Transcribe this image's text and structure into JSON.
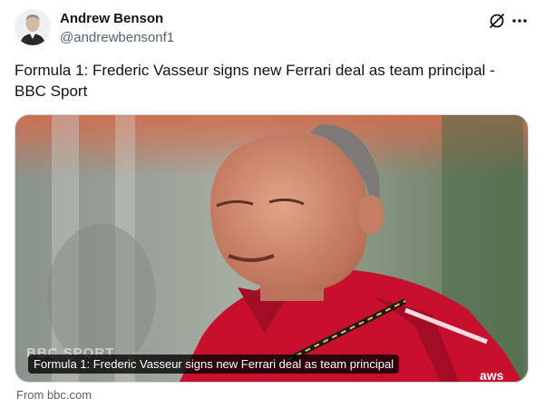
{
  "author": {
    "name": "Andrew Benson",
    "handle": "@andrewbensonf1"
  },
  "tweet": {
    "text": "Formula 1: Frederic Vasseur signs new Ferrari deal as team principal - BBC Sport"
  },
  "card": {
    "caption": "Formula 1: Frederic Vasseur signs new Ferrari deal as team principal",
    "watermark": "BBC SPORT",
    "source": "From bbc.com"
  },
  "icons": {
    "grok": "grok-icon",
    "more": "more-icon"
  },
  "colors": {
    "text": "#0f1419",
    "secondary": "#536471",
    "ferrari_red": "#c8102e"
  }
}
